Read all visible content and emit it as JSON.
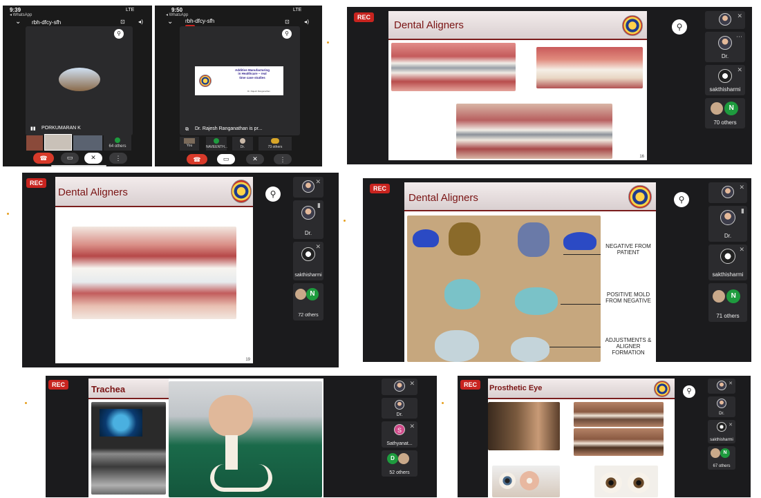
{
  "phone1": {
    "time": "9:39",
    "carrier": "◂ WhatsApp",
    "signal": "LTE",
    "meeting_code": "rbh-dfcy-sfh",
    "speaker_name": "PORKUMARAN K",
    "others_label": "64 others"
  },
  "phone2": {
    "time": "9:50",
    "carrier": "◂ WhatsApp",
    "signal": "LTE",
    "meeting_code": "rbh-dfcy-sfh",
    "slide_title": "Additive Manufacturing in Healthcare – real time case studies",
    "slide_author": "Dr. Rajesh Ranganathan",
    "presenting_label": "Dr. Rajesh Ranganathan is pr...",
    "thumb_you": "You",
    "thumb_second": "NAVEENTH...",
    "thumb_third": "Dr.",
    "others_label": "73 others"
  },
  "meet1": {
    "rec": "REC",
    "slide_title": "Dental Aligners",
    "page": "16",
    "tiles": [
      {
        "label": ""
      },
      {
        "label": "Dr."
      },
      {
        "label": "sakthisharmi"
      },
      {
        "label": "70 others",
        "badge": "N"
      }
    ]
  },
  "meet2": {
    "rec": "REC",
    "slide_title": "Dental Aligners",
    "page": "19",
    "tiles": [
      {
        "label": ""
      },
      {
        "label": "Dr."
      },
      {
        "label": "sakthisharmi"
      },
      {
        "label": "72 others",
        "badge": "N"
      }
    ]
  },
  "meet3": {
    "rec": "REC",
    "slide_title": "Dental Aligners",
    "notes": {
      "negative": "NEGATIVE FROM PATIENT",
      "positive": "POSITIVE MOLD FROM NEGATIVE",
      "adjust": "ADJUSTMENTS & ALIGNER FORMATION"
    },
    "tiles": [
      {
        "label": ""
      },
      {
        "label": "Dr."
      },
      {
        "label": "sakthisharmi"
      },
      {
        "label": "71 others",
        "badge": "N"
      }
    ]
  },
  "meet4": {
    "rec": "REC",
    "slide_title": "Trachea",
    "tiles": [
      {
        "label": ""
      },
      {
        "label": "Dr."
      },
      {
        "label": "Sathyanat...",
        "badge": "S"
      },
      {
        "label": "52 others",
        "badge": "D"
      }
    ]
  },
  "meet5": {
    "rec": "REC",
    "slide_title": "Prosthetic Eye",
    "tiles": [
      {
        "label": ""
      },
      {
        "label": "Dr."
      },
      {
        "label": "sakthisharmi"
      },
      {
        "label": "67 others",
        "badge": "N"
      }
    ]
  },
  "colors": {
    "rec_red": "#c8241f",
    "title_red": "#7a1414",
    "panel_dark": "#1b1b1d",
    "badge_green": "#1e9b3e",
    "badge_pink": "#d04a8a"
  }
}
